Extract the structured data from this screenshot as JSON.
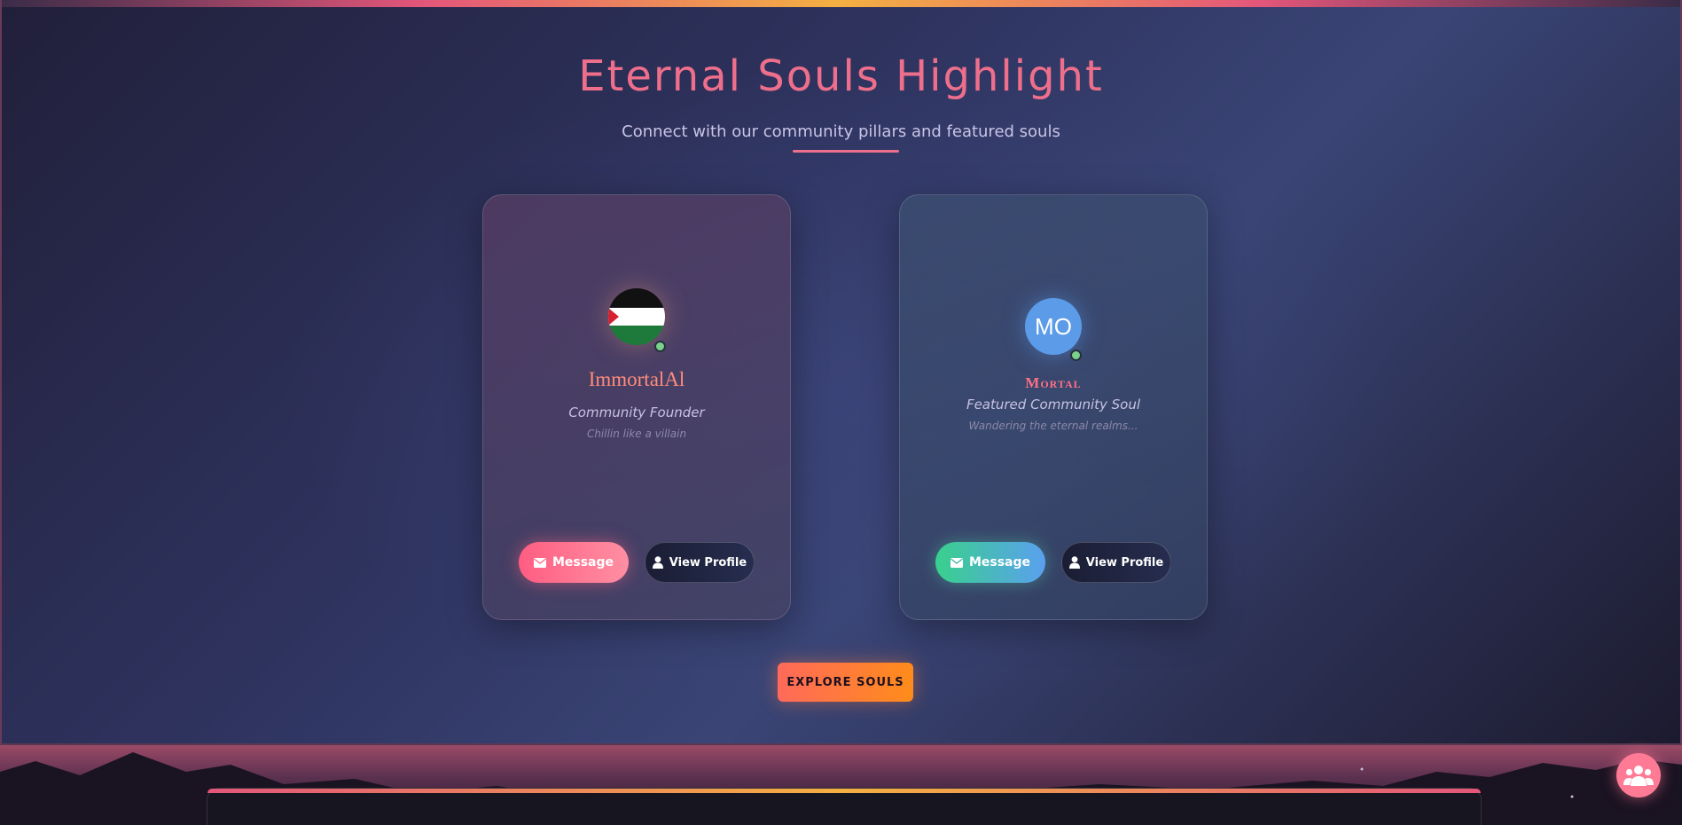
{
  "header": {
    "title": "Eternal Souls Highlight",
    "subtitle": "Connect with our community pillars and featured souls"
  },
  "cards": [
    {
      "name": "ImmortalAl",
      "role": "Community Founder",
      "bio": "Chillin like a villain",
      "avatar": "palestine-flag",
      "status": "online",
      "message_label": "Message",
      "view_label": "View Profile"
    },
    {
      "name": "Mortal",
      "initials": "MO",
      "role": "Featured Community Soul",
      "bio": "Wandering the eternal realms...",
      "status": "online",
      "message_label": "Message",
      "view_label": "View Profile"
    }
  ],
  "explore_label": "EXPLORE SOULS",
  "icons": {
    "message": "mail-icon",
    "profile": "user-icon",
    "fab": "users-group-icon"
  },
  "colors": {
    "accent_pink": "#ee6f8b",
    "accent_orange": "#ff8c1a",
    "online": "#7bd08a",
    "avatar_blue": "#5b9be8"
  }
}
